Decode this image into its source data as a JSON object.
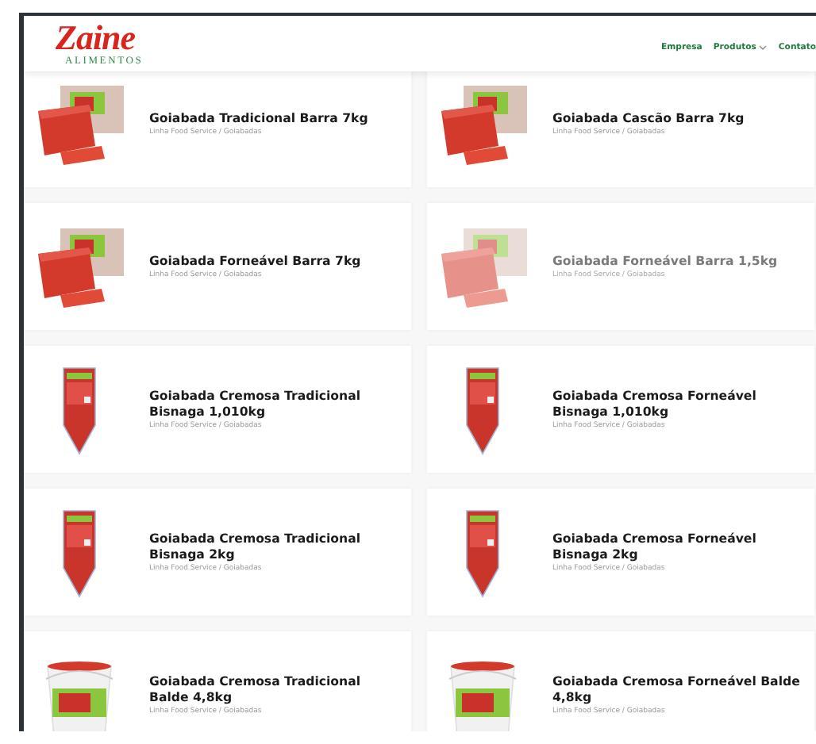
{
  "header": {
    "logo": {
      "name": "Zaine",
      "tagline": "ALIMENTOS"
    },
    "nav": [
      {
        "label": "Empresa",
        "dropdown": false
      },
      {
        "label": "Produtos",
        "dropdown": true
      },
      {
        "label": "Contato",
        "dropdown": false
      }
    ]
  },
  "products": [
    {
      "title": "Goiabada Tradicional Barra 7kg",
      "category": "Linha Food Service / Goiabadas",
      "kind": "bar",
      "faded": false
    },
    {
      "title": "Goiabada Cascão Barra 7kg",
      "category": "Linha Food Service / Goiabadas",
      "kind": "bar",
      "faded": false
    },
    {
      "title": "Goiabada Forneável Barra 7kg",
      "category": "Linha Food Service / Goiabadas",
      "kind": "bar",
      "faded": false
    },
    {
      "title": "Goiabada Forneável Barra 1,5kg",
      "category": "Linha Food Service / Goiabadas",
      "kind": "bar",
      "faded": true
    },
    {
      "title": "Goiabada Cremosa Tradicional Bisnaga 1,010kg",
      "category": "Linha Food Service / Goiabadas",
      "kind": "tube",
      "faded": false
    },
    {
      "title": "Goiabada Cremosa Forneável Bisnaga 1,010kg",
      "category": "Linha Food Service / Goiabadas",
      "kind": "tube",
      "faded": false
    },
    {
      "title": "Goiabada Cremosa Tradicional Bisnaga 2kg",
      "category": "Linha Food Service / Goiabadas",
      "kind": "tube",
      "faded": false
    },
    {
      "title": "Goiabada Cremosa Forneável Bisnaga 2kg",
      "category": "Linha Food Service / Goiabadas",
      "kind": "tube",
      "faded": false
    },
    {
      "title": "Goiabada Cremosa Tradicional Balde 4,8kg",
      "category": "Linha Food Service / Goiabadas",
      "kind": "bucket",
      "faded": false
    },
    {
      "title": "Goiabada Cremosa Forneável Balde 4,8kg",
      "category": "Linha Food Service / Goiabadas",
      "kind": "bucket",
      "faded": false
    }
  ]
}
